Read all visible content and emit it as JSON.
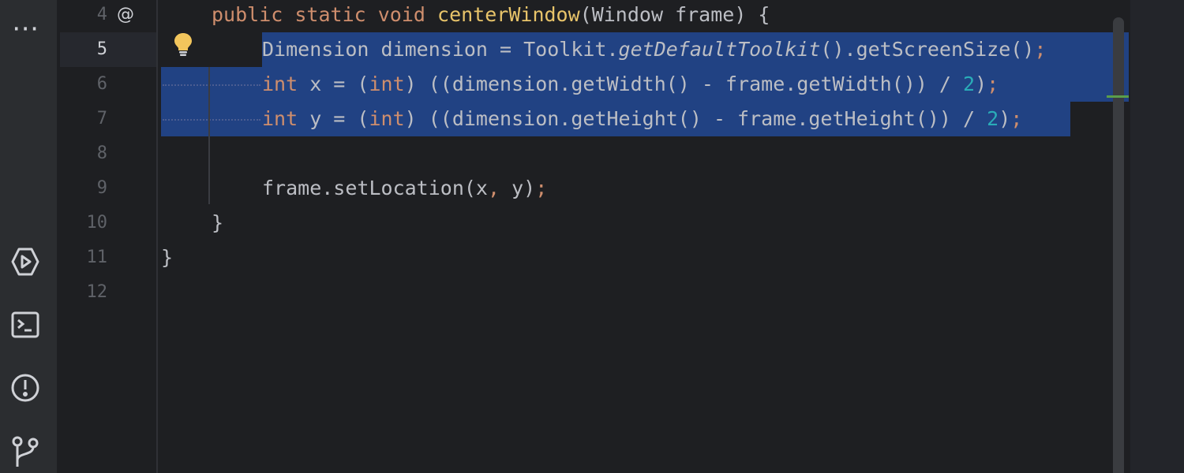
{
  "toolstrip": {
    "items": [
      {
        "name": "more-icon",
        "glyph": "⋯"
      },
      {
        "name": "run-icon"
      },
      {
        "name": "terminal-icon"
      },
      {
        "name": "problems-icon"
      },
      {
        "name": "git-icon"
      }
    ]
  },
  "gutter": {
    "lines": [
      "4",
      "5",
      "6",
      "7",
      "8",
      "9",
      "10",
      "11",
      "12"
    ],
    "current_line": "5",
    "override_marker": "@"
  },
  "code": {
    "line4": {
      "kw1": "public",
      "kw2": "static",
      "kw3": "void",
      "method": "centerWindow",
      "rest": "(Window frame) {"
    },
    "line5": {
      "a": "Dimension dimension = Toolkit.",
      "b": "getDefaultToolkit",
      "c": "().getScreenSize()",
      "semi": ";"
    },
    "line6": {
      "kw": "int",
      "a": " x = (",
      "kw2": "int",
      "b": ") ((dimension.getWidth() - frame.getWidth()) / ",
      "num": "2",
      "c": ")",
      "semi": ";"
    },
    "line7": {
      "kw": "int",
      "a": " y = (",
      "kw2": "int",
      "b": ") ((dimension.getHeight() - frame.getHeight()) / ",
      "num": "2",
      "c": ")",
      "semi": ";"
    },
    "line9": {
      "a": "frame.setLocation(x",
      "comma": ",",
      "b": " y)",
      "semi": ";"
    },
    "line10": {
      "a": "}"
    },
    "line11": {
      "a": "}"
    }
  },
  "colors": {
    "background": "#1e1f22",
    "selection": "#214283",
    "keyword": "#cf8e6d",
    "method": "#e8c46a",
    "number": "#2aacb8"
  }
}
